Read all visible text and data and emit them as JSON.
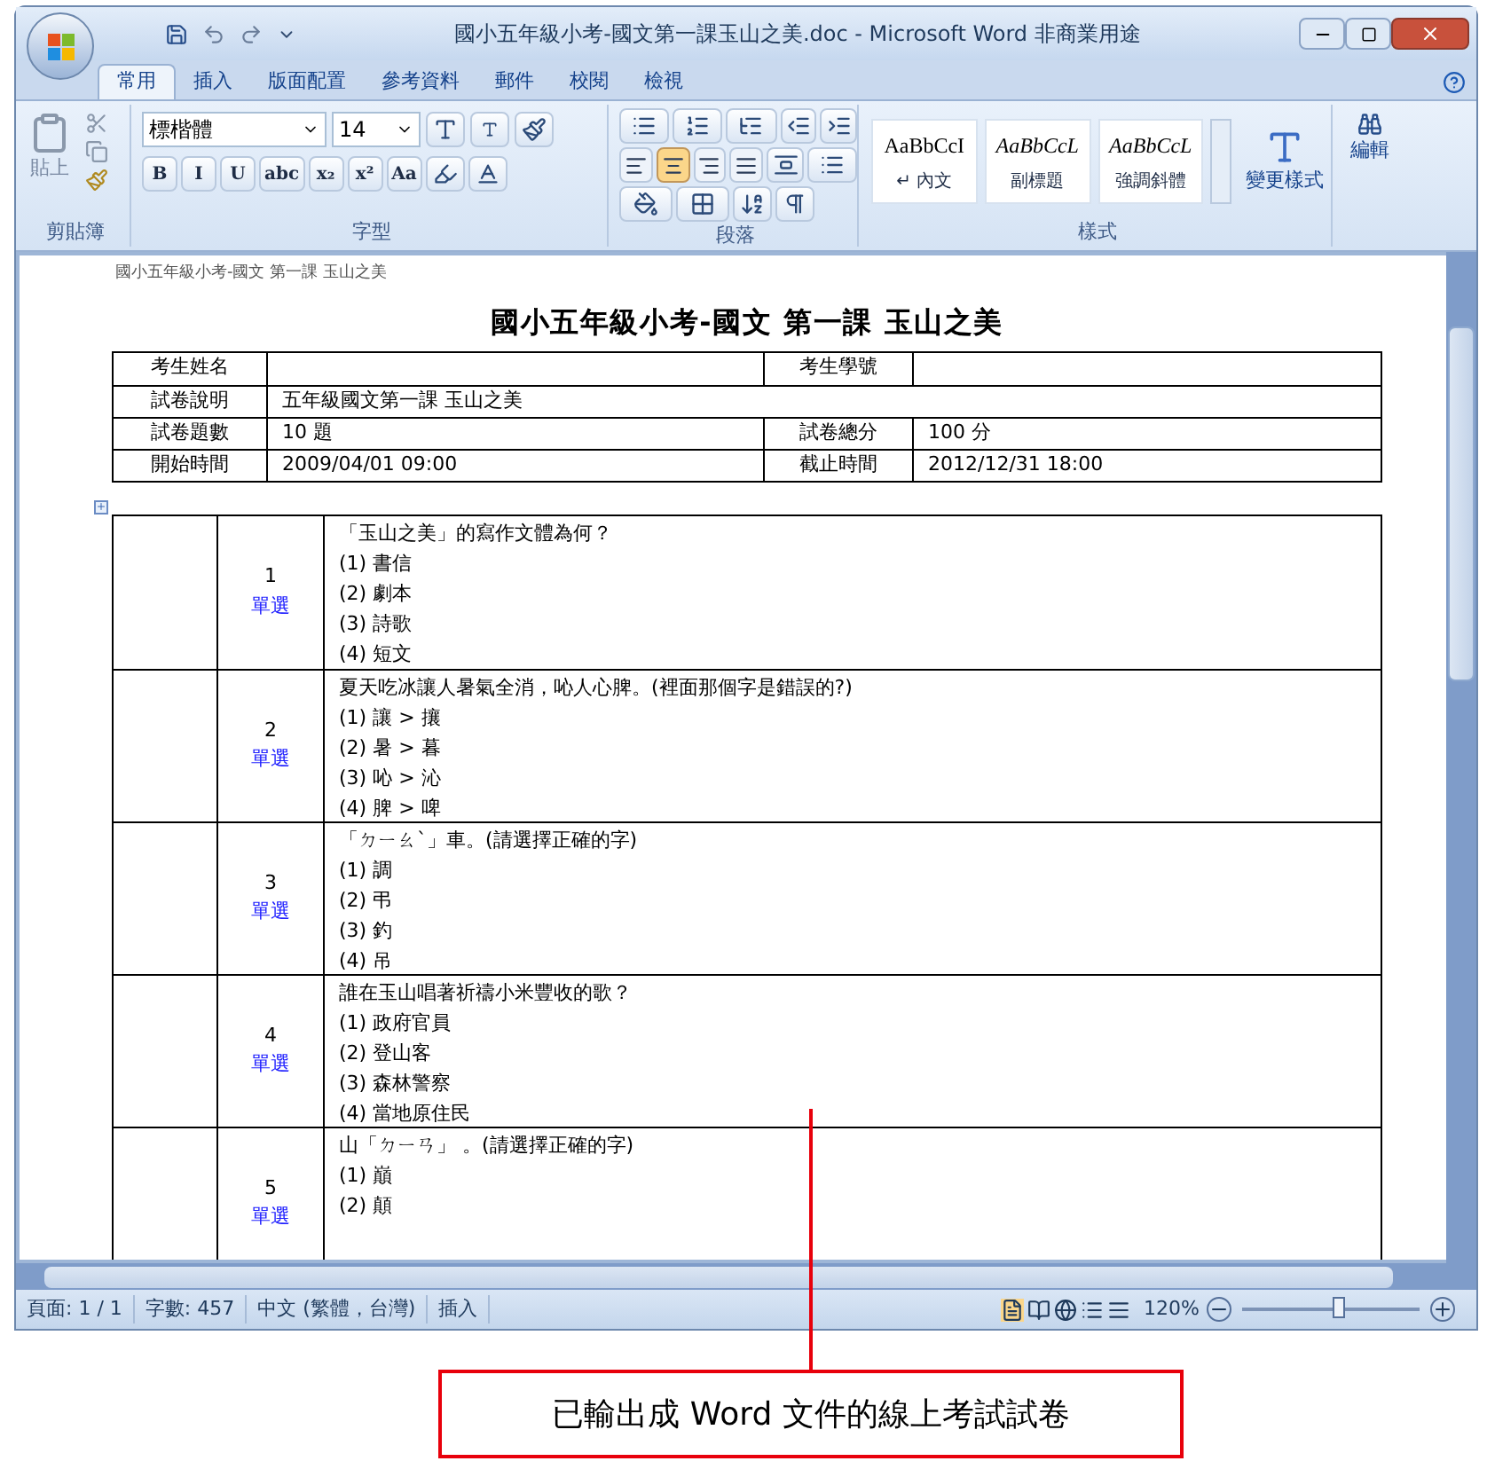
{
  "window": {
    "title": "國小五年級小考-國文第一課玉山之美.doc - Microsoft Word 非商業用途"
  },
  "tabs": [
    {
      "label": "常用",
      "selected": true
    },
    {
      "label": "插入",
      "selected": false
    },
    {
      "label": "版面配置",
      "selected": false
    },
    {
      "label": "參考資料",
      "selected": false
    },
    {
      "label": "郵件",
      "selected": false
    },
    {
      "label": "校閱",
      "selected": false
    },
    {
      "label": "檢視",
      "selected": false
    }
  ],
  "ribbon": {
    "clipboard": {
      "label": "剪貼簿",
      "paste": "貼上"
    },
    "font": {
      "label": "字型",
      "font_name": "標楷體",
      "font_size": "14",
      "format_buttons": [
        "B",
        "I",
        "U",
        "abc",
        "x₂",
        "x²",
        "Aa"
      ]
    },
    "paragraph": {
      "label": "段落",
      "alignment": [
        {
          "kind": "left",
          "selected": false
        },
        {
          "kind": "center",
          "selected": true
        },
        {
          "kind": "right",
          "selected": false
        },
        {
          "kind": "justify",
          "selected": false
        }
      ]
    },
    "styles": {
      "label": "樣式",
      "items": [
        {
          "preview": "AaBbCcI",
          "name": "↵ 內文",
          "italic": false
        },
        {
          "preview": "AaBbCcL",
          "name": "副標題",
          "italic": true
        },
        {
          "preview": "AaBbCcL",
          "name": "強調斜體",
          "italic": true
        }
      ],
      "change_styles": "變更樣式"
    },
    "editing": {
      "label": "編輯"
    }
  },
  "document": {
    "header": "國小五年級小考-國文 第一課 玉山之美",
    "title": "國小五年級小考-國文 第一課 玉山之美",
    "info_rows": [
      {
        "cells": [
          "考生姓名",
          "",
          "考生學號",
          ""
        ]
      },
      {
        "cells": [
          "試卷說明",
          "五年級國文第一課 玉山之美"
        ]
      },
      {
        "cells": [
          "試卷題數",
          "10 題",
          "試卷總分",
          "100 分"
        ]
      },
      {
        "cells": [
          "開始時間",
          "2009/04/01 09:00",
          "截止時間",
          "2012/12/31 18:00"
        ]
      }
    ],
    "questions": [
      {
        "number": "1",
        "type": "單選",
        "question": "「玉山之美」的寫作文體為何？",
        "options": [
          "(1) 書信",
          "(2) 劇本",
          "(3) 詩歌",
          "(4) 短文"
        ]
      },
      {
        "number": "2",
        "type": "單選",
        "question": "夏天吃冰讓人暑氣全消，吣人心脾。(裡面那個字是錯誤的?)",
        "options": [
          "(1) 讓 > 攘",
          "(2) 暑 > 暮",
          "(3) 吣 > 沁",
          "(4) 脾 > 啤"
        ]
      },
      {
        "number": "3",
        "type": "單選",
        "question": "「ㄉㄧㄠˋ」車。(請選擇正確的字)",
        "options": [
          "(1) 調",
          "(2) 弔",
          "(3) 釣",
          "(4) 吊"
        ]
      },
      {
        "number": "4",
        "type": "單選",
        "question": "誰在玉山唱著祈禱小米豐收的歌？",
        "options": [
          "(1) 政府官員",
          "(2) 登山客",
          "(3) 森林警察",
          "(4) 當地原住民"
        ]
      },
      {
        "number": "5",
        "type": "單選",
        "question": "山「ㄉㄧㄢ」 。(請選擇正確的字)",
        "options": [
          "(1) 巔",
          "(2) 顛"
        ]
      }
    ]
  },
  "status_bar": {
    "items": [
      "頁面: 1 / 1",
      "字數: 457",
      "中文 (繁體，台灣)",
      "插入"
    ],
    "zoom": "120%",
    "zoom_level": {
      "level": 0.55
    }
  },
  "callout": {
    "text": "已輸出成 Word 文件的線上考試試卷"
  }
}
